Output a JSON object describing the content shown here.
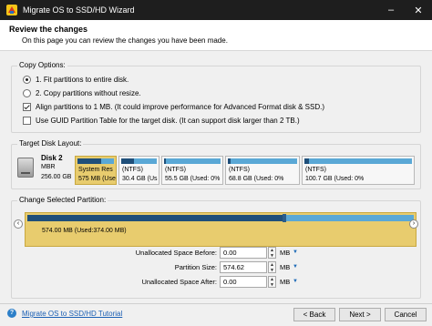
{
  "window": {
    "title": "Migrate OS to SSD/HD Wizard",
    "controls": [
      "–",
      "✕"
    ]
  },
  "header": {
    "title": "Review the changes",
    "subtitle": "On this page you can review the changes you have been made."
  },
  "copy_options": {
    "legend": "Copy Options:",
    "items": [
      {
        "type": "radio",
        "checked": true,
        "label": "1. Fit partitions to entire disk."
      },
      {
        "type": "radio",
        "checked": false,
        "label": "2. Copy partitions without resize."
      },
      {
        "type": "checkbox",
        "checked": true,
        "label": "Align partitions to 1 MB.  (It could improve performance for Advanced Format disk & SSD.)"
      },
      {
        "type": "checkbox",
        "checked": false,
        "label": "Use GUID Partition Table for the target disk. (It can support disk larger than 2 TB.)"
      }
    ]
  },
  "target_disk": {
    "legend": "Target Disk Layout:",
    "disk": {
      "name": "Disk 2",
      "type": "MBR",
      "size": "256.00 GB"
    },
    "partitions": [
      {
        "name": "System Res",
        "size": "575 MB (Use",
        "used_fraction": 0.65,
        "selected": true
      },
      {
        "name": "(NTFS)",
        "size": "30.4 GB (Us",
        "used_fraction": 0.35,
        "selected": false
      },
      {
        "name": "(NTFS)",
        "size": "55.5 GB (Used: 0%",
        "used_fraction": 0.04,
        "selected": false
      },
      {
        "name": "(NTFS)",
        "size": "68.8 GB (Used: 0%",
        "used_fraction": 0.04,
        "selected": false
      },
      {
        "name": "(NTFS)",
        "size": "100.7 GB (Used: 0%",
        "used_fraction": 0.04,
        "selected": false
      }
    ]
  },
  "change_partition": {
    "legend": "Change Selected Partition:",
    "label": "574.00 MB (Used:374.00 MB)",
    "used_fraction": 0.66,
    "fields": [
      {
        "label": "Unallocated Space Before:",
        "value": "0.00",
        "unit": "MB"
      },
      {
        "label": "Partition Size:",
        "value": "574.62",
        "unit": "MB"
      },
      {
        "label": "Unallocated Space After:",
        "value": "0.00",
        "unit": "MB"
      }
    ]
  },
  "footer": {
    "help_icon": "?",
    "tutorial_link": "Migrate OS to SSD/HD Tutorial",
    "back": "< Back",
    "next": "Next >",
    "cancel": "Cancel"
  },
  "colors": {
    "accent_blue": "#5aa8d6",
    "used_dark": "#1f4f7a",
    "selected_gold": "#e8cc6e",
    "link_blue": "#1a5fb4"
  }
}
